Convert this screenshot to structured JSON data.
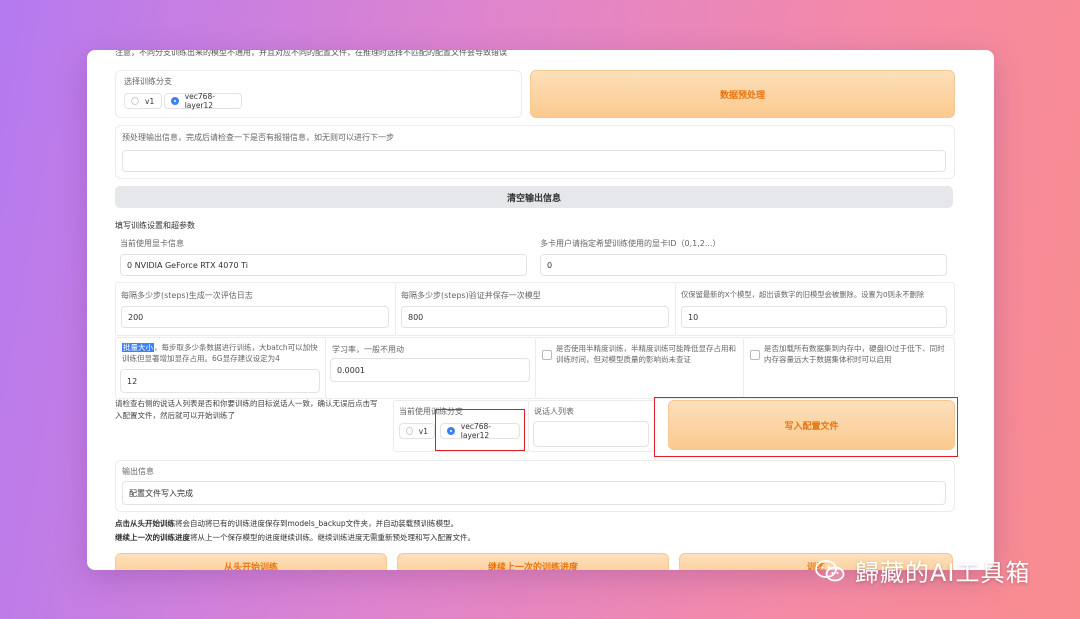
{
  "top_note": "注意，不同分支训练出来的模型不通用，并且对应不同的配置文件，在推理时选择不匹配的配置文件会导致错误",
  "branch_section": {
    "label": "选择训练分支",
    "options": [
      "v1",
      "vec768-layer12"
    ],
    "selected": "vec768-layer12"
  },
  "preprocess_button": "数据预处理",
  "preprocess_output": {
    "label": "预处理输出信息，完成后请检查一下是否有报错信息，如无则可以进行下一步",
    "value": ""
  },
  "clear_button": "清空输出信息",
  "training_params_title": "填写训练设置和超参数",
  "gpu_info": {
    "label": "当前使用显卡信息",
    "value": "0 NVIDIA GeForce RTX 4070 Ti"
  },
  "gpu_id": {
    "label": "多卡用户请指定希望训练使用的显卡ID（0,1,2...）",
    "value": "0"
  },
  "log_interval": {
    "label": "每隔多少步(steps)生成一次评估日志",
    "value": "200"
  },
  "eval_interval": {
    "label": "每隔多少步(steps)验证并保存一次模型",
    "value": "800"
  },
  "keep_ckpts": {
    "label": "仅保留最新的X个模型，超出该数字的旧模型会被删除。设置为0则永不删除",
    "value": "10"
  },
  "batch_size": {
    "label_highlight": "批量大小",
    "label_rest": "，每步取多少条数据进行训练，大batch可以加快训练但显著增加显存占用。6G显存建议设定为4",
    "value": "12"
  },
  "learning_rate": {
    "label": "学习率，一般不用动",
    "value": "0.0001"
  },
  "half_precision": {
    "label": "是否使用半精度训练，半精度训练可能降低显存占用和训练时间，但对模型质量的影响尚未查证"
  },
  "load_all_data": {
    "label": "是否加载所有数据集到内存中，硬盘IO过于低下、同时内存容量远大于数据集体积时可以启用"
  },
  "speaker_check_note": "请检查右侧的说话人列表是否和你要训练的目标说话人一致，确认无误后点击写入配置文件，然后就可以开始训练了",
  "current_branch": {
    "label": "当前使用训练分支",
    "options": [
      "v1",
      "vec768-layer12"
    ],
    "selected": "vec768-layer12"
  },
  "speaker_list": {
    "label": "说话人列表",
    "value": ""
  },
  "write_config_button": "写入配置文件",
  "output_info": {
    "label": "输出信息",
    "value": "配置文件写入完成"
  },
  "notes": {
    "line1_bold": "点击从头开始训练",
    "line1_rest": "将会自动将已有的训练进度保存到models_backup文件夹，并自动装载预训练模型。",
    "line2_bold": "继续上一次的训练进度",
    "line2_rest": "将从上一个保存模型的进度继续训练。继续训练进度无需重新预处理和写入配置文件。"
  },
  "bottom_buttons": [
    "从头开始训练",
    "继续上一次的训练进度",
    "训练"
  ],
  "watermark_text": "歸藏的AI工具箱",
  "colors": {
    "accent_orange": "#e8750f",
    "highlight_red": "#e11d26",
    "radio_blue": "#3b82f6"
  }
}
